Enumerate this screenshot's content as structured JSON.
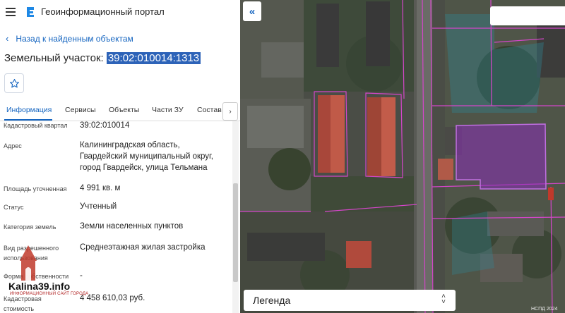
{
  "header": {
    "title": "Геоинформационный портал"
  },
  "nav": {
    "back_label": "Назад к найденным объектам"
  },
  "parcel": {
    "label": "Земельный участок:",
    "number": "39:02:010014:1313"
  },
  "tabs": [
    {
      "label": "Информация",
      "active": true
    },
    {
      "label": "Сервисы"
    },
    {
      "label": "Объекты"
    },
    {
      "label": "Части ЗУ"
    },
    {
      "label": "Состав"
    }
  ],
  "info": [
    {
      "label": "Кадастровый квартал",
      "value": "39:02:010014"
    },
    {
      "label": "Адрес",
      "value": "Калининградская область, Гвардейский муниципальный округ, город Гвардейск, улица Тельмана"
    },
    {
      "label": "Площадь уточненная",
      "value": "4 991 кв. м"
    },
    {
      "label": "Статус",
      "value": "Учтенный"
    },
    {
      "label": "Категория земель",
      "value": "Земли населенных пунктов"
    },
    {
      "label": "Вид разрешенного использования",
      "value": "Среднеэтажная жилая застройка"
    },
    {
      "label": "Форма собственности",
      "value": "-"
    },
    {
      "label": "Кадастровая стоимость",
      "value": "4 458 610,03 руб."
    }
  ],
  "watermark": {
    "site": "Kalina39.info",
    "tagline": "ИНФОРМАЦИОННЫЙ САЙТ ГОРОДА"
  },
  "map": {
    "collapse_label": "«",
    "legend_label": "Легенда",
    "copyright": "НСПД 2024"
  },
  "colors": {
    "accent": "#1565c0",
    "highlight": "#2d63b8",
    "parcel_fill": "#8a2db8"
  }
}
